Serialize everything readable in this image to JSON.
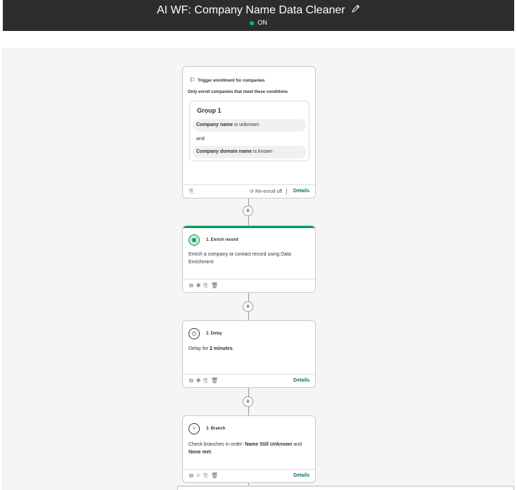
{
  "header": {
    "title": "AI WF: Company Name Data Cleaner",
    "status": "ON",
    "status_color": "#00bd6e",
    "edit_icon": "pencil-icon"
  },
  "trigger": {
    "heading": "Trigger enrollment for companies",
    "subheading": "Only enroll companies that meet these conditions",
    "group_title": "Group 1",
    "conditions": [
      {
        "property": "Company name",
        "operator": "is unknown"
      },
      {
        "property": "Company domain name",
        "operator": "is known"
      }
    ],
    "connector_word": "and",
    "reenroll_label": "Re-enroll off",
    "details_label": "Details"
  },
  "steps": [
    {
      "title": "1. Enrich record",
      "icon": "enrich-icon",
      "body": "Enrich a company or contact record using Data Enrichment"
    },
    {
      "title": "2. Delay",
      "icon": "timer-icon",
      "body_prefix": "Delay for ",
      "body_bold": "2 minutes",
      "body_suffix": ".",
      "details_label": "Details"
    },
    {
      "title": "3. Branch",
      "icon": "branch-icon",
      "body_prefix": "Check branches in order: ",
      "body_bold1": "Name Still Unknown",
      "body_mid": " and ",
      "body_bold2": "None met",
      "body_suffix": ".",
      "details_label": "Details"
    }
  ],
  "colors": {
    "header_bg": "#2d2d2d",
    "accent_green": "#00a05a",
    "details_teal": "#0d6f70",
    "canvas_bg": "#f5f5f5"
  }
}
